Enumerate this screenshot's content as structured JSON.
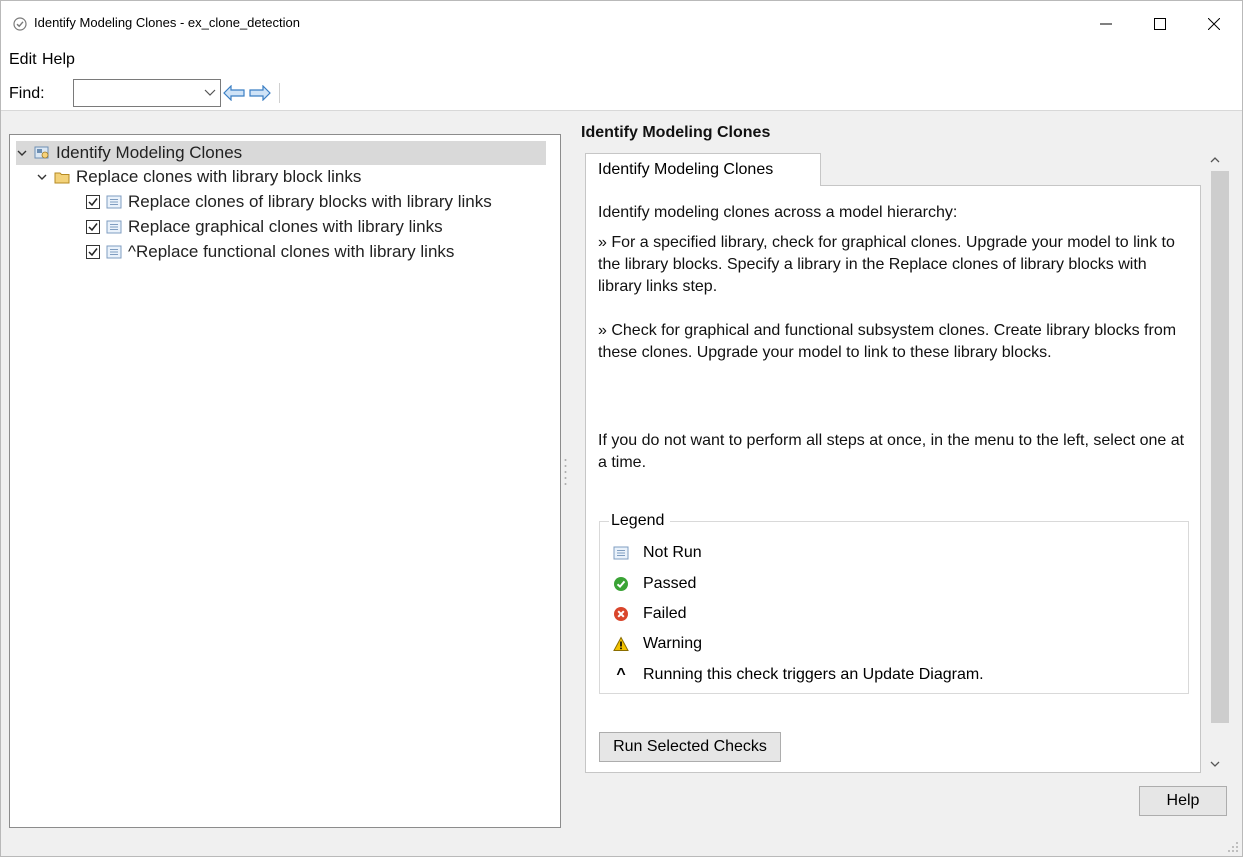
{
  "window": {
    "title": "Identify Modeling Clones - ex_clone_detection"
  },
  "menu": {
    "edit": "Edit",
    "help": "Help"
  },
  "toolbar": {
    "find_label": "Find:",
    "find_value": ""
  },
  "tree": {
    "root": "Identify Modeling Clones",
    "folder": "Replace clones with library block links",
    "items": [
      {
        "label": "Replace clones of library blocks with library links",
        "checked": true
      },
      {
        "label": "Replace graphical clones with library links",
        "checked": true
      },
      {
        "label": "^Replace functional clones with library links",
        "checked": true
      }
    ]
  },
  "detail": {
    "title": "Identify Modeling Clones",
    "tab_label": "Identify Modeling Clones",
    "intro": "Identify modeling clones across a model hierarchy:",
    "bullet1": "» For a specified library, check for graphical clones. Upgrade your model to link to the library blocks. Specify a library in the Replace clones of library blocks with library links step.",
    "bullet2": "» Check for graphical and functional subsystem clones. Create library blocks from these clones. Upgrade your model to link to these library blocks.",
    "note": "If you do not want to perform all steps at once, in the menu to the left, select one at a time."
  },
  "legend": {
    "title": "Legend",
    "items": [
      {
        "icon": "not-run-icon",
        "label": "Not Run"
      },
      {
        "icon": "passed-icon",
        "label": "Passed"
      },
      {
        "icon": "failed-icon",
        "label": "Failed"
      },
      {
        "icon": "warning-icon",
        "label": "Warning"
      },
      {
        "icon": "caret",
        "symbol": "^",
        "label": "Running this check triggers an Update Diagram."
      }
    ]
  },
  "buttons": {
    "run_selected": "Run Selected Checks",
    "help": "Help"
  },
  "colors": {
    "passed": "#3aa335",
    "failed": "#d9452b",
    "warning": "#f2c200",
    "selection": "#d9d9d9"
  }
}
